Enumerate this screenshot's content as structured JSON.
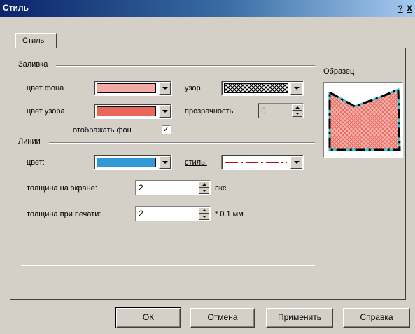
{
  "window": {
    "title": "Стиль",
    "help_button": "?",
    "close_button": "X"
  },
  "tab": {
    "label": "Стиль"
  },
  "fill": {
    "group_label": "Заливка",
    "bg_color_label": "цвет фона",
    "bg_color": "#f2aaa6",
    "pattern_color_label": "цвет узора",
    "pattern_color": "#e8675a",
    "show_bg_label": "отображать фон",
    "show_bg_checked": "✓",
    "pattern_label": "узор",
    "pattern_icon": "crosshatch-pattern",
    "transparency_label": "прозрачность",
    "transparency_value": "0"
  },
  "lines": {
    "group_label": "Линии",
    "color_label": "цвет:",
    "color": "#2f9ad6",
    "style_label": "стиль:",
    "style_icon": "dash-dot-line-red",
    "screen_width_label": "толщина на экране:",
    "screen_width_value": "2",
    "screen_width_unit": "пкс",
    "print_width_label": "толщина при печати:",
    "print_width_value": "2",
    "print_width_unit": "* 0.1 мм"
  },
  "preview": {
    "label": "Образец"
  },
  "buttons": {
    "ok": "ОК",
    "cancel": "Отмена",
    "apply": "Применить",
    "help": "Справка"
  }
}
